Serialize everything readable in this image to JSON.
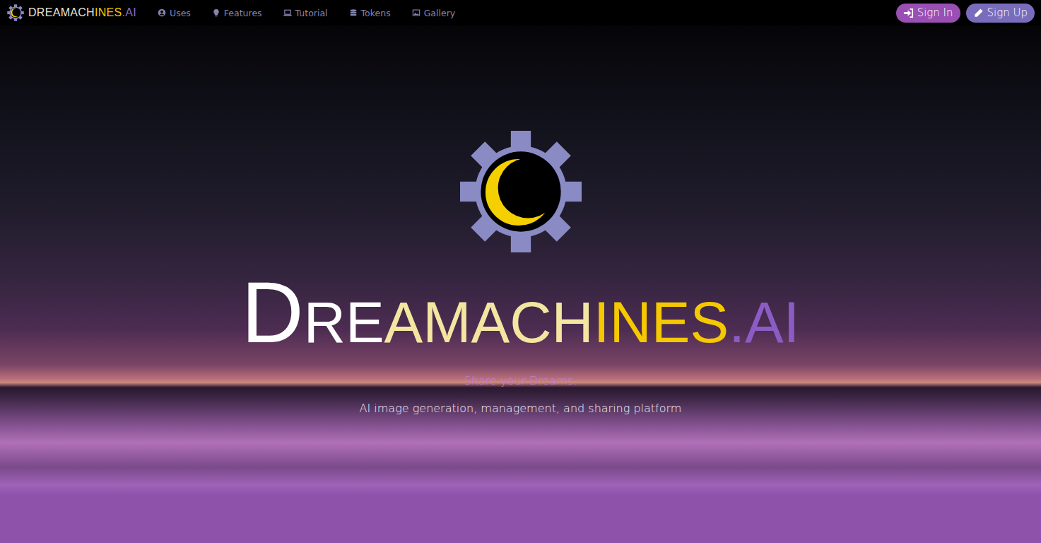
{
  "nav": {
    "brand": [
      {
        "text": "DREAMACH",
        "color": "#e8e4d8"
      },
      {
        "text": "INES",
        "color": "#f5c800"
      },
      {
        "text": ".AI",
        "color": "#8b6cc8"
      }
    ],
    "items": [
      {
        "label": "Uses",
        "icon": "user"
      },
      {
        "label": "Features",
        "icon": "bulb"
      },
      {
        "label": "Tutorial",
        "icon": "laptop"
      },
      {
        "label": "Tokens",
        "icon": "coins"
      },
      {
        "label": "Gallery",
        "icon": "image"
      }
    ]
  },
  "auth": {
    "sign_in": "Sign In",
    "sign_up": "Sign Up"
  },
  "hero": {
    "title": [
      {
        "text": "DRE",
        "color": "#ffffff"
      },
      {
        "text": "AMACH",
        "color": "#f3e6a0"
      },
      {
        "text": "INES",
        "color": "#f5c800"
      },
      {
        "text": ".AI",
        "color": "#8a5cc4"
      }
    ],
    "tagline": "Share your Dreams.",
    "subtitle": "AI image generation, management, and sharing platform"
  }
}
